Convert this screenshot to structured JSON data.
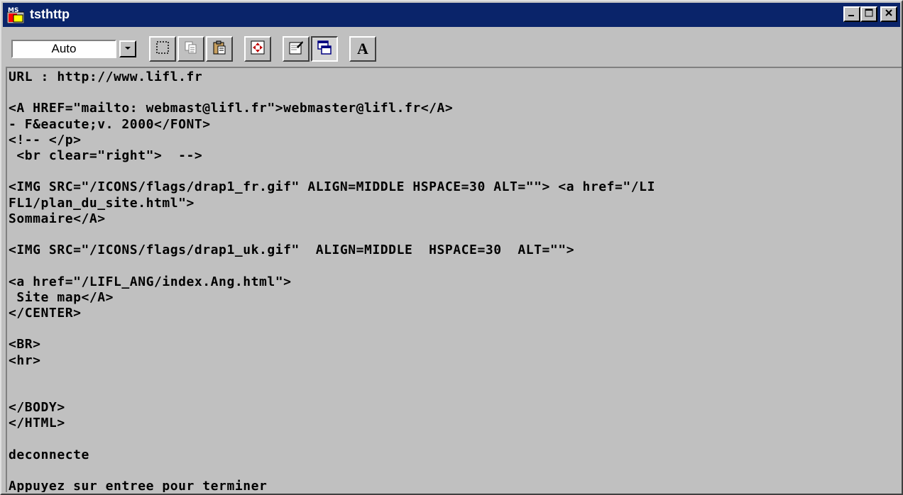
{
  "window": {
    "title": "tsthttp",
    "title_icon": "ms-dos-app-icon",
    "controls": [
      "minimize-icon",
      "maximize-icon",
      "close-icon"
    ]
  },
  "toolbar": {
    "font_size_value": "Auto",
    "buttons": [
      "mark-icon",
      "copy-icon",
      "paste-icon",
      "fullscreen-icon",
      "properties-icon",
      "background-icon",
      "font-icon"
    ],
    "font_button_label": "A"
  },
  "console": {
    "lines": [
      "URL : http://www.lifl.fr",
      "",
      "<A HREF=\"mailto: webmast@lifl.fr\">webmaster@lifl.fr</A>",
      "- F&eacute;v. 2000</FONT>",
      "<!-- </p>",
      " <br clear=\"right\">  -->",
      "",
      "<IMG SRC=\"/ICONS/flags/drap1_fr.gif\" ALIGN=MIDDLE HSPACE=30 ALT=\"\"> <a href=\"/LI",
      "FL1/plan_du_site.html\">",
      "Sommaire</A>",
      "",
      "<IMG SRC=\"/ICONS/flags/drap1_uk.gif\"  ALIGN=MIDDLE  HSPACE=30  ALT=\"\">",
      "",
      "<a href=\"/LIFL_ANG/index.Ang.html\">",
      " Site map</A>",
      "</CENTER>",
      "",
      "<BR>",
      "<hr>",
      "",
      "",
      "</BODY>",
      "</HTML>",
      "",
      "deconnecte",
      "",
      "Appuyez sur entree pour terminer"
    ]
  }
}
